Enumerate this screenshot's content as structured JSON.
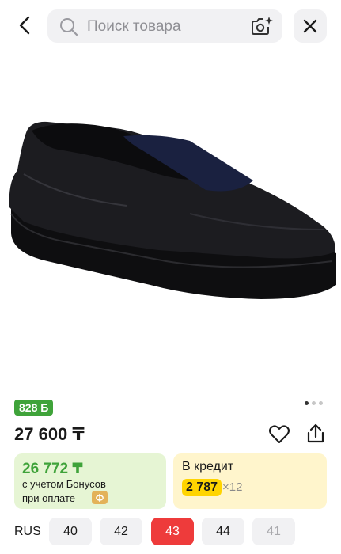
{
  "header": {
    "search_placeholder": "Поиск товара",
    "icons": {
      "back": "chevron-left-icon",
      "search": "search-icon",
      "camera": "camera-sparkle-icon",
      "close": "close-icon"
    }
  },
  "product": {
    "image": "black-leather-slip-on-sneaker",
    "bonus_badge": "828 Б",
    "gallery": {
      "total": 3,
      "active_index": 0
    },
    "price": "27 600 ₸"
  },
  "bonus_card": {
    "amount": "26 772 ₸",
    "line1": "с учетом Бонусов",
    "line2": "при оплате",
    "coin_glyph": "ф"
  },
  "credit_card": {
    "title": "В кредит",
    "monthly": "2 787",
    "multiplier": "×12"
  },
  "sizes": {
    "label": "RUS",
    "options": [
      "40",
      "42",
      "43",
      "44",
      "41"
    ],
    "selected": "43",
    "disabled": [
      "41"
    ]
  },
  "colors": {
    "green": "#3fa33a",
    "red": "#ee3b3b",
    "yellow": "#ffd400",
    "coin": "#e3b259"
  }
}
